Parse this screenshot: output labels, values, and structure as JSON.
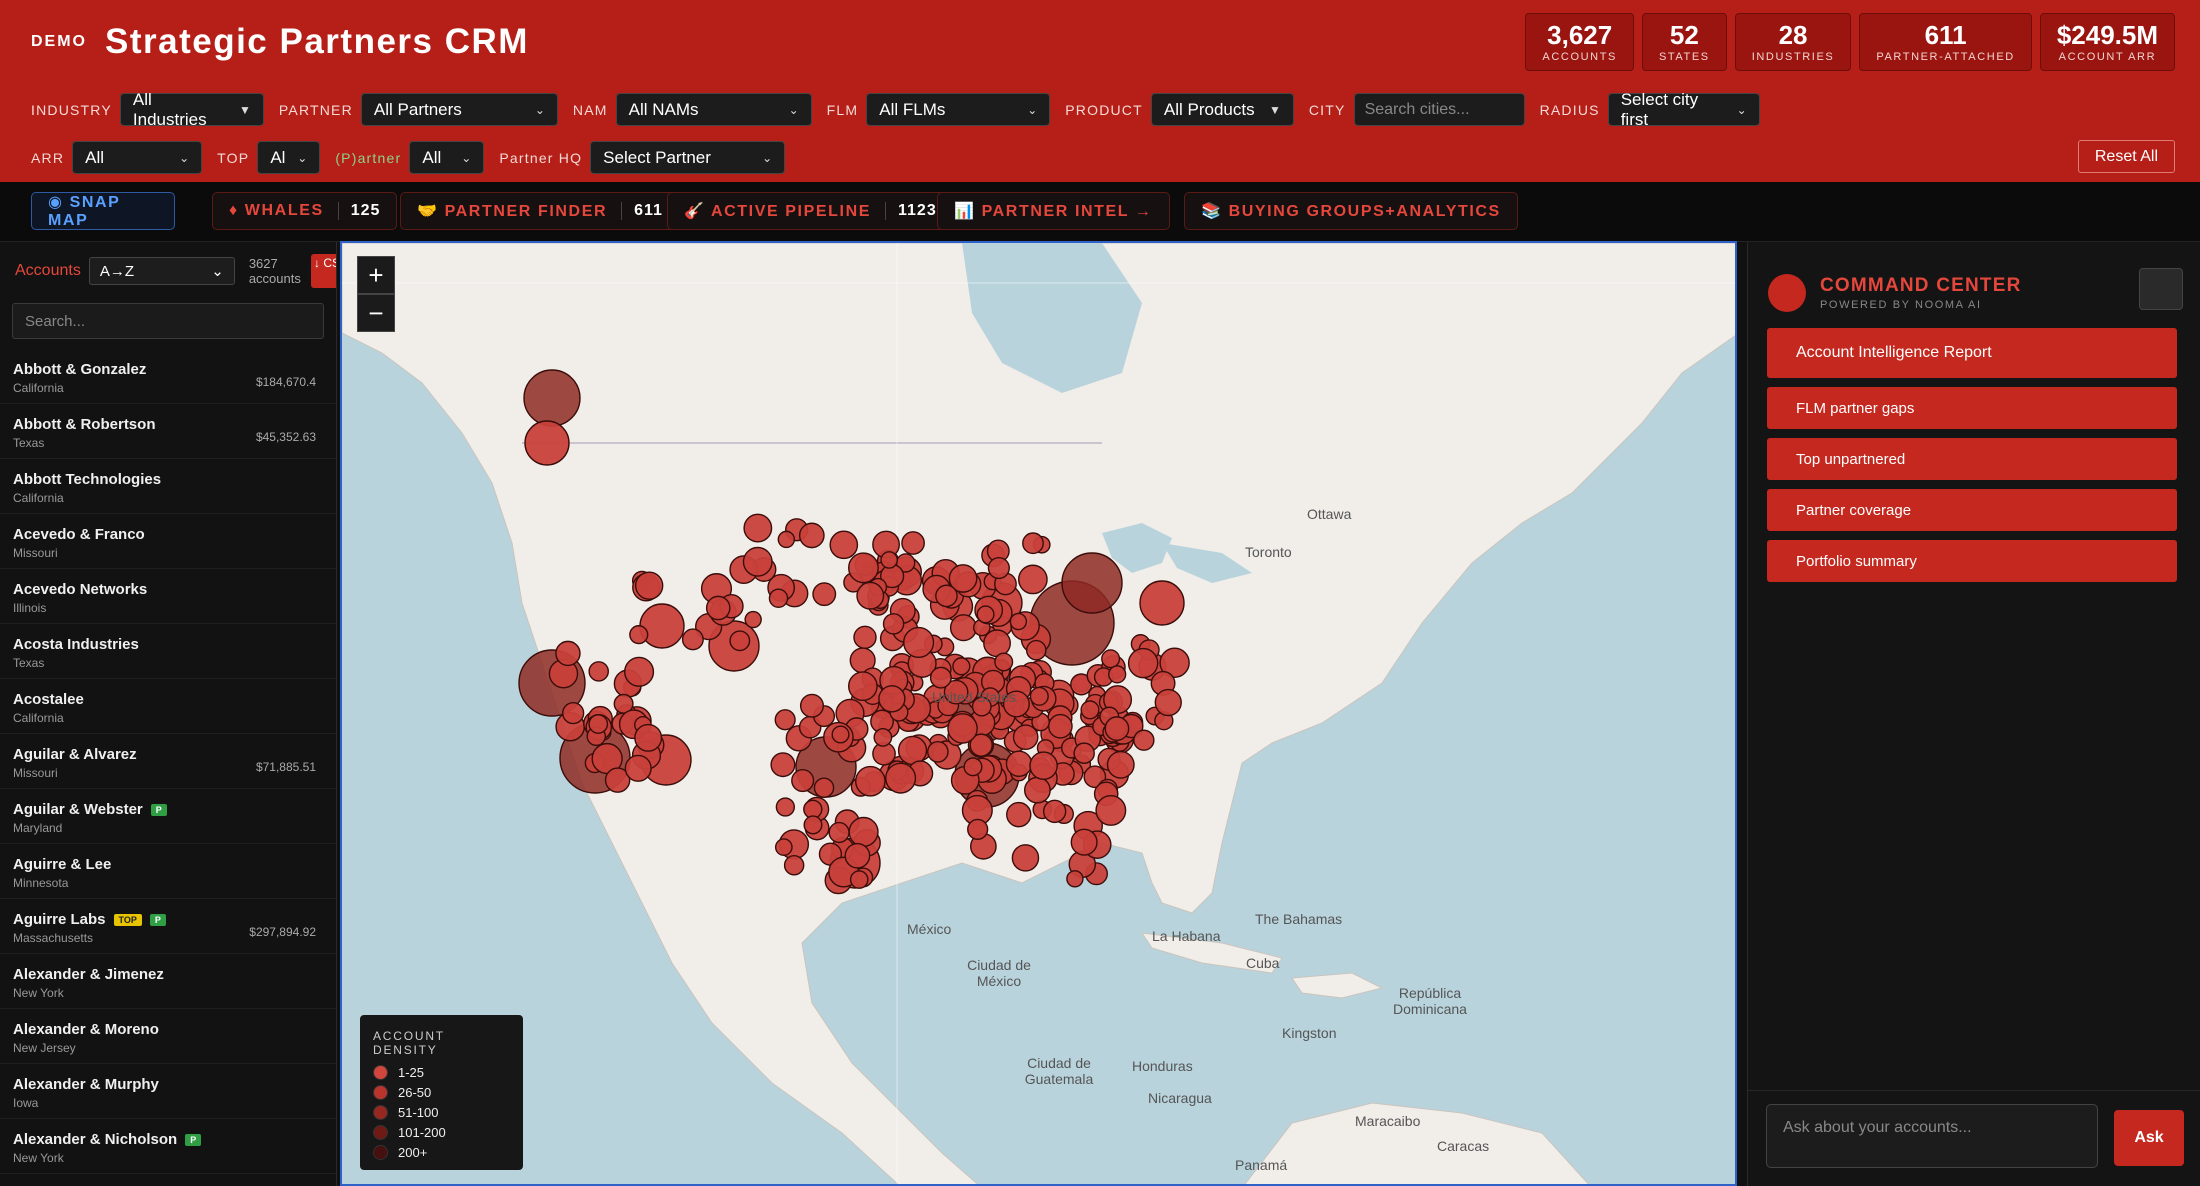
{
  "header": {
    "demo": "DEMO",
    "title": "Strategic Partners CRM",
    "stats": [
      {
        "value": "3,627",
        "label": "ACCOUNTS"
      },
      {
        "value": "52",
        "label": "STATES"
      },
      {
        "value": "28",
        "label": "INDUSTRIES"
      },
      {
        "value": "611",
        "label": "PARTNER-ATTACHED"
      },
      {
        "value": "$249.5M",
        "label": "ACCOUNT ARR"
      }
    ]
  },
  "filters": {
    "industry": {
      "label": "INDUSTRY",
      "value": "All Industries"
    },
    "partner": {
      "label": "PARTNER",
      "value": "All Partners"
    },
    "nam": {
      "label": "NAM",
      "value": "All NAMs"
    },
    "flm": {
      "label": "FLM",
      "value": "All FLMs"
    },
    "product": {
      "label": "PRODUCT",
      "value": "All Products"
    },
    "city": {
      "label": "CITY",
      "placeholder": "Search cities..."
    },
    "radius": {
      "label": "RADIUS",
      "value": "Select city first"
    },
    "arr": {
      "label": "ARR",
      "value": "All"
    },
    "top": {
      "label": "TOP",
      "value": "Al"
    },
    "ppartner": {
      "label": "(P)artner",
      "value": "All"
    },
    "partner_hq": {
      "label": "Partner HQ",
      "value": "Select Partner"
    },
    "reset": "Reset All"
  },
  "quickbar": {
    "snap": "◉ SNAP MAP",
    "whales": {
      "label": "♦ WHALES",
      "count": "125"
    },
    "finder": {
      "label": "🤝 PARTNER FINDER",
      "count": "611"
    },
    "pipeline": {
      "label": "🎸 ACTIVE PIPELINE",
      "count": "1123"
    },
    "intel": "📊 PARTNER INTEL →",
    "buying": "📚 BUYING GROUPS+ANALYTICS"
  },
  "sidebar": {
    "label": "Accounts",
    "sort": "A→Z",
    "count_num": "3627",
    "count_word": "accounts",
    "csv": "↓ CSV",
    "search_placeholder": "Search...",
    "accounts": [
      {
        "name": "Abbott & Gonzalez",
        "state": "California",
        "arr": "$184,670.4",
        "tags": []
      },
      {
        "name": "Abbott & Robertson",
        "state": "Texas",
        "arr": "$45,352.63",
        "tags": []
      },
      {
        "name": "Abbott Technologies",
        "state": "California",
        "arr": "",
        "tags": []
      },
      {
        "name": "Acevedo & Franco",
        "state": "Missouri",
        "arr": "",
        "tags": []
      },
      {
        "name": "Acevedo Networks",
        "state": "Illinois",
        "arr": "",
        "tags": []
      },
      {
        "name": "Acosta Industries",
        "state": "Texas",
        "arr": "",
        "tags": []
      },
      {
        "name": "Acostalee",
        "state": "California",
        "arr": "",
        "tags": []
      },
      {
        "name": "Aguilar & Alvarez",
        "state": "Missouri",
        "arr": "$71,885.51",
        "tags": []
      },
      {
        "name": "Aguilar & Webster",
        "state": "Maryland",
        "arr": "",
        "tags": [
          "P"
        ]
      },
      {
        "name": "Aguirre & Lee",
        "state": "Minnesota",
        "arr": "",
        "tags": []
      },
      {
        "name": "Aguirre Labs",
        "state": "Massachusetts",
        "arr": "$297,894.92",
        "tags": [
          "TOP",
          "P"
        ]
      },
      {
        "name": "Alexander & Jimenez",
        "state": "New York",
        "arr": "",
        "tags": []
      },
      {
        "name": "Alexander & Moreno",
        "state": "New Jersey",
        "arr": "",
        "tags": []
      },
      {
        "name": "Alexander & Murphy",
        "state": "Iowa",
        "arr": "",
        "tags": []
      },
      {
        "name": "Alexander & Nicholson",
        "state": "New York",
        "arr": "",
        "tags": [
          "P"
        ]
      }
    ]
  },
  "map": {
    "legend_title": "ACCOUNT DENSITY",
    "legend": [
      "1-25",
      "26-50",
      "51-100",
      "101-200",
      "200+"
    ],
    "labels": [
      "Ottawa",
      "Toronto",
      "United States",
      "México",
      "Ciudad de México",
      "La Habana",
      "Cuba",
      "The Bahamas",
      "República Dominicana",
      "Kingston",
      "Ciudad de Guatemala",
      "Honduras",
      "Nicaragua",
      "Panamá",
      "Maracaibo",
      "Caracas"
    ]
  },
  "command": {
    "title": "COMMAND CENTER",
    "subtitle": "POWERED BY NOOMA AI",
    "actions": [
      "Account Intelligence Report",
      "FLM partner gaps",
      "Top unpartnered",
      "Partner coverage",
      "Portfolio summary"
    ],
    "ask_placeholder": "Ask about your accounts...",
    "ask_button": "Ask"
  },
  "colors": {
    "brand_red": "#b51f18",
    "accent_blue": "#2f62c8",
    "cluster": "#c8403a"
  }
}
